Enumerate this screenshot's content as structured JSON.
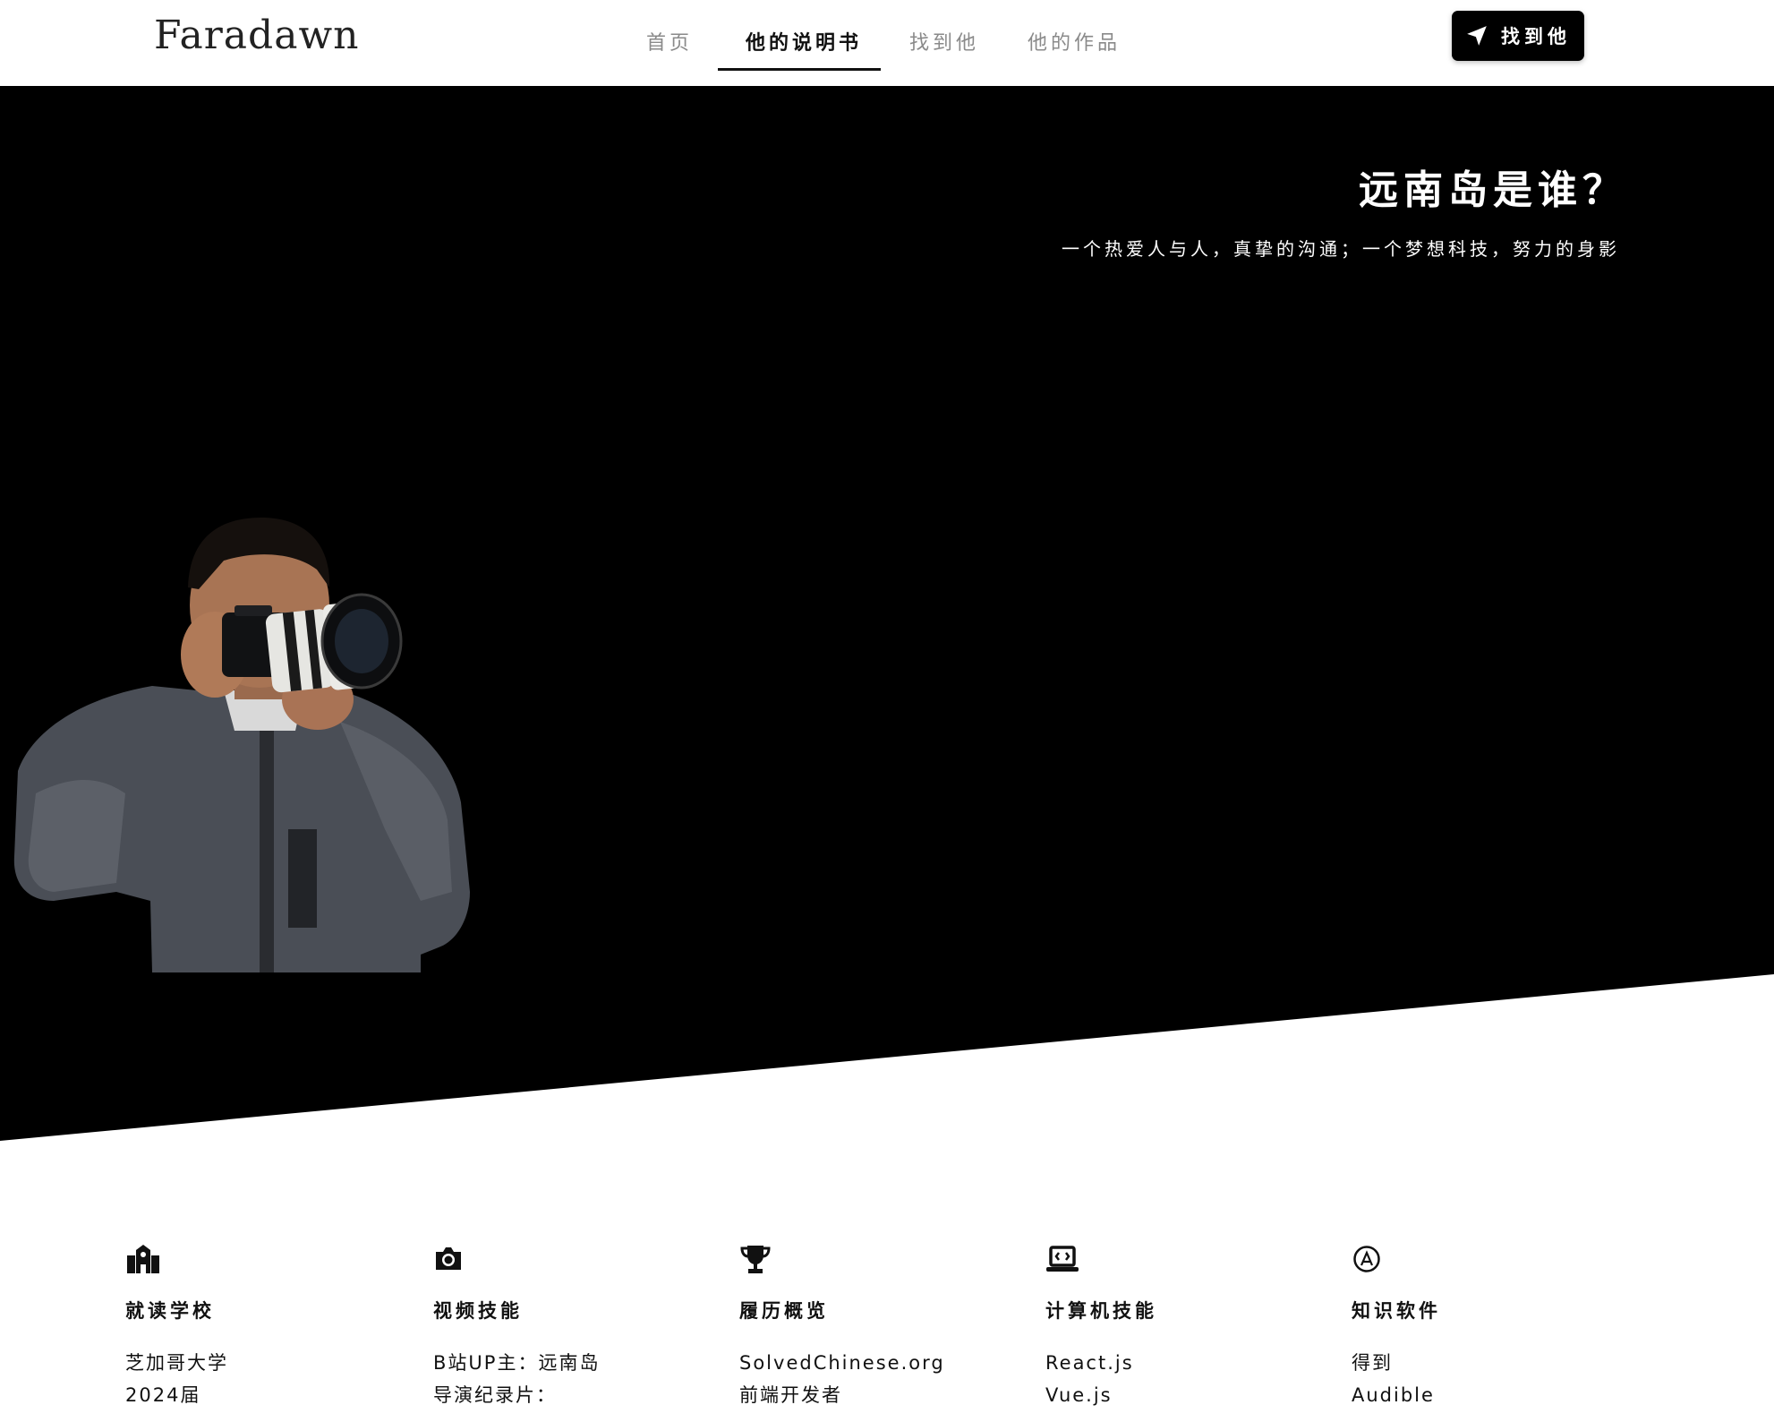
{
  "header": {
    "brand": "Faradawn",
    "nav": [
      {
        "label": "首页",
        "active": false
      },
      {
        "label": "他的说明书",
        "active": true
      },
      {
        "label": "找到他",
        "active": false
      },
      {
        "label": "他的作品",
        "active": false
      }
    ],
    "cta_label": "找到他",
    "cta_icon": "send-arrow-icon"
  },
  "hero": {
    "title": "远南岛是谁？",
    "subtitle": "一个热爱人与人，真挚的沟通；一个梦想科技，努力的身影",
    "background": "#000000",
    "photo_icon": "person-with-camera-photo"
  },
  "info": [
    {
      "icon": "school-icon",
      "title": "就读学校",
      "lines": [
        "芝加哥大学",
        "2024届"
      ]
    },
    {
      "icon": "camera-icon",
      "title": "视频技能",
      "lines": [
        "B站UP主：远南岛",
        "导演纪录片："
      ]
    },
    {
      "icon": "trophy-icon",
      "title": "履历概览",
      "lines": [
        "SolvedChinese.org",
        "前端开发者"
      ]
    },
    {
      "icon": "laptop-code-icon",
      "title": "计算机技能",
      "lines": [
        "React.js",
        "Vue.js"
      ]
    },
    {
      "icon": "app-store-icon",
      "title": "知识软件",
      "lines": [
        "得到",
        "Audible"
      ]
    }
  ]
}
